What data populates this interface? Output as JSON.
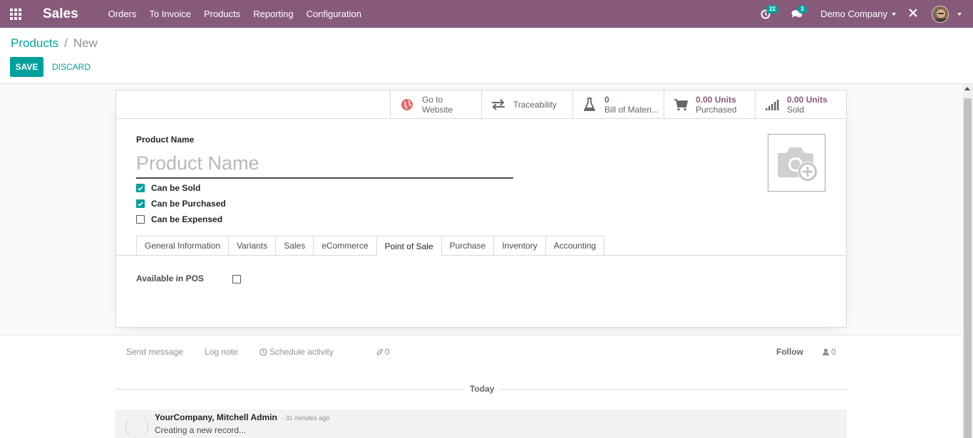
{
  "navbar": {
    "brand": "Sales",
    "menu": [
      "Orders",
      "To Invoice",
      "Products",
      "Reporting",
      "Configuration"
    ],
    "activity_badge": "22",
    "messages_badge": "3",
    "company": "Demo Company",
    "bg_color": "#875a7b"
  },
  "breadcrumb": {
    "parent": "Products",
    "separator": "/",
    "current": "New"
  },
  "actions": {
    "save": "SAVE",
    "discard": "DISCARD"
  },
  "smart_buttons": {
    "website": {
      "line1": "Go to",
      "line2": "Website"
    },
    "traceability": {
      "label": "Traceability"
    },
    "bom": {
      "value": "0",
      "label": "Bill of Materi..."
    },
    "purchased": {
      "value": "0.00 Units",
      "label": "Purchased"
    },
    "sold": {
      "value": "0.00 Units",
      "label": "Sold"
    }
  },
  "form": {
    "name_label": "Product Name",
    "name_placeholder": "Product Name",
    "name_value": "",
    "checkboxes": [
      {
        "label": "Can be Sold",
        "checked": true
      },
      {
        "label": "Can be Purchased",
        "checked": true
      },
      {
        "label": "Can be Expensed",
        "checked": false
      }
    ],
    "tabs": [
      "General Information",
      "Variants",
      "Sales",
      "eCommerce",
      "Point of Sale",
      "Purchase",
      "Inventory",
      "Accounting"
    ],
    "active_tab": "Point of Sale",
    "pos": {
      "label": "Available in POS",
      "checked": false
    }
  },
  "chatter": {
    "send_message": "Send message",
    "log_note": "Log note",
    "schedule_activity": "Schedule activity",
    "attachments": "0",
    "follow": "Follow",
    "followers": "0",
    "date_separator": "Today",
    "message": {
      "author": "YourCompany, Mitchell Admin",
      "time": "- 31 minutes ago",
      "body": "Creating a new record..."
    }
  },
  "colors": {
    "primary": "#00a09d",
    "brand": "#875a7b"
  }
}
